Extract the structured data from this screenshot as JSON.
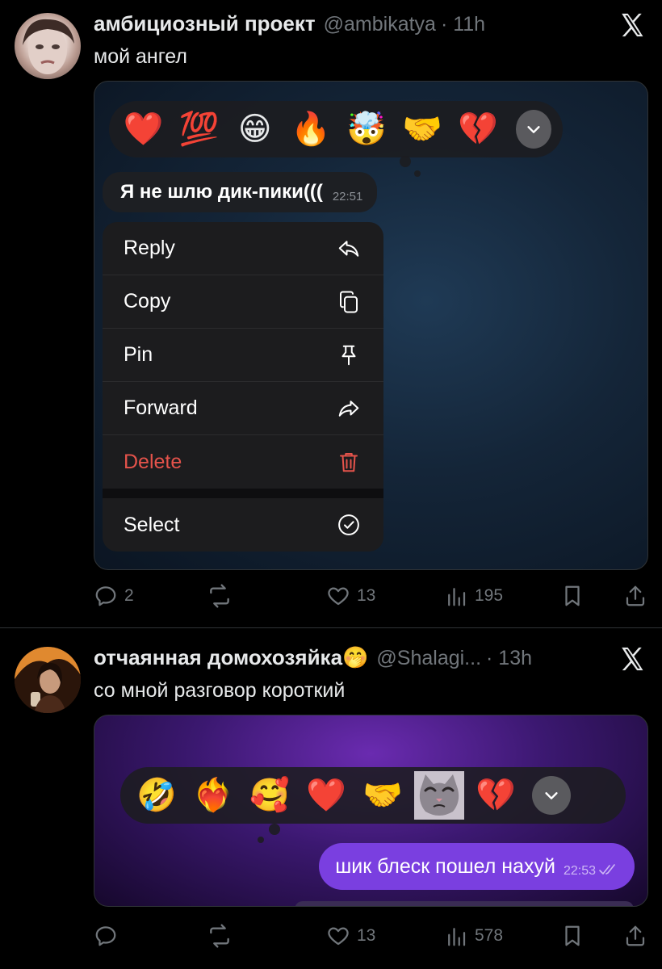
{
  "tweets": [
    {
      "name": "амбициозный проект",
      "handle": "@ambikatya",
      "time": "· 11h",
      "text": "мой ангел",
      "media": {
        "reactions": [
          "❤️",
          "💯",
          "😁",
          "🔥",
          "🤯",
          "🤝",
          "💔"
        ],
        "message": "Я не шлю дик-пики(((",
        "message_time": "22:51",
        "menu": [
          {
            "label": "Reply",
            "icon": "reply-icon"
          },
          {
            "label": "Copy",
            "icon": "copy-icon"
          },
          {
            "label": "Pin",
            "icon": "pin-icon"
          },
          {
            "label": "Forward",
            "icon": "forward-icon"
          },
          {
            "label": "Delete",
            "icon": "trash-icon"
          },
          {
            "label": "Select",
            "icon": "check-circle-icon"
          }
        ]
      },
      "stats": {
        "replies": "2",
        "retweets": "",
        "likes": "13",
        "views": "195"
      }
    },
    {
      "name": "отчаянная домохозяйка🤭",
      "handle": "@Shalagi...",
      "time": "· 13h",
      "text": "со мной разговор короткий",
      "media": {
        "reactions": [
          "🤣",
          "❤️‍🔥",
          "🥰",
          "❤️",
          "🤝",
          "cat-sticker",
          "💔"
        ],
        "message": "шик блеск пошел нахуй",
        "message_time": "22:53"
      },
      "stats": {
        "replies": "",
        "retweets": "",
        "likes": "13",
        "views": "578"
      }
    }
  ],
  "colors": {
    "accent_purple": "#7a3fe0",
    "danger": "#e5534b",
    "muted": "#71767b"
  }
}
